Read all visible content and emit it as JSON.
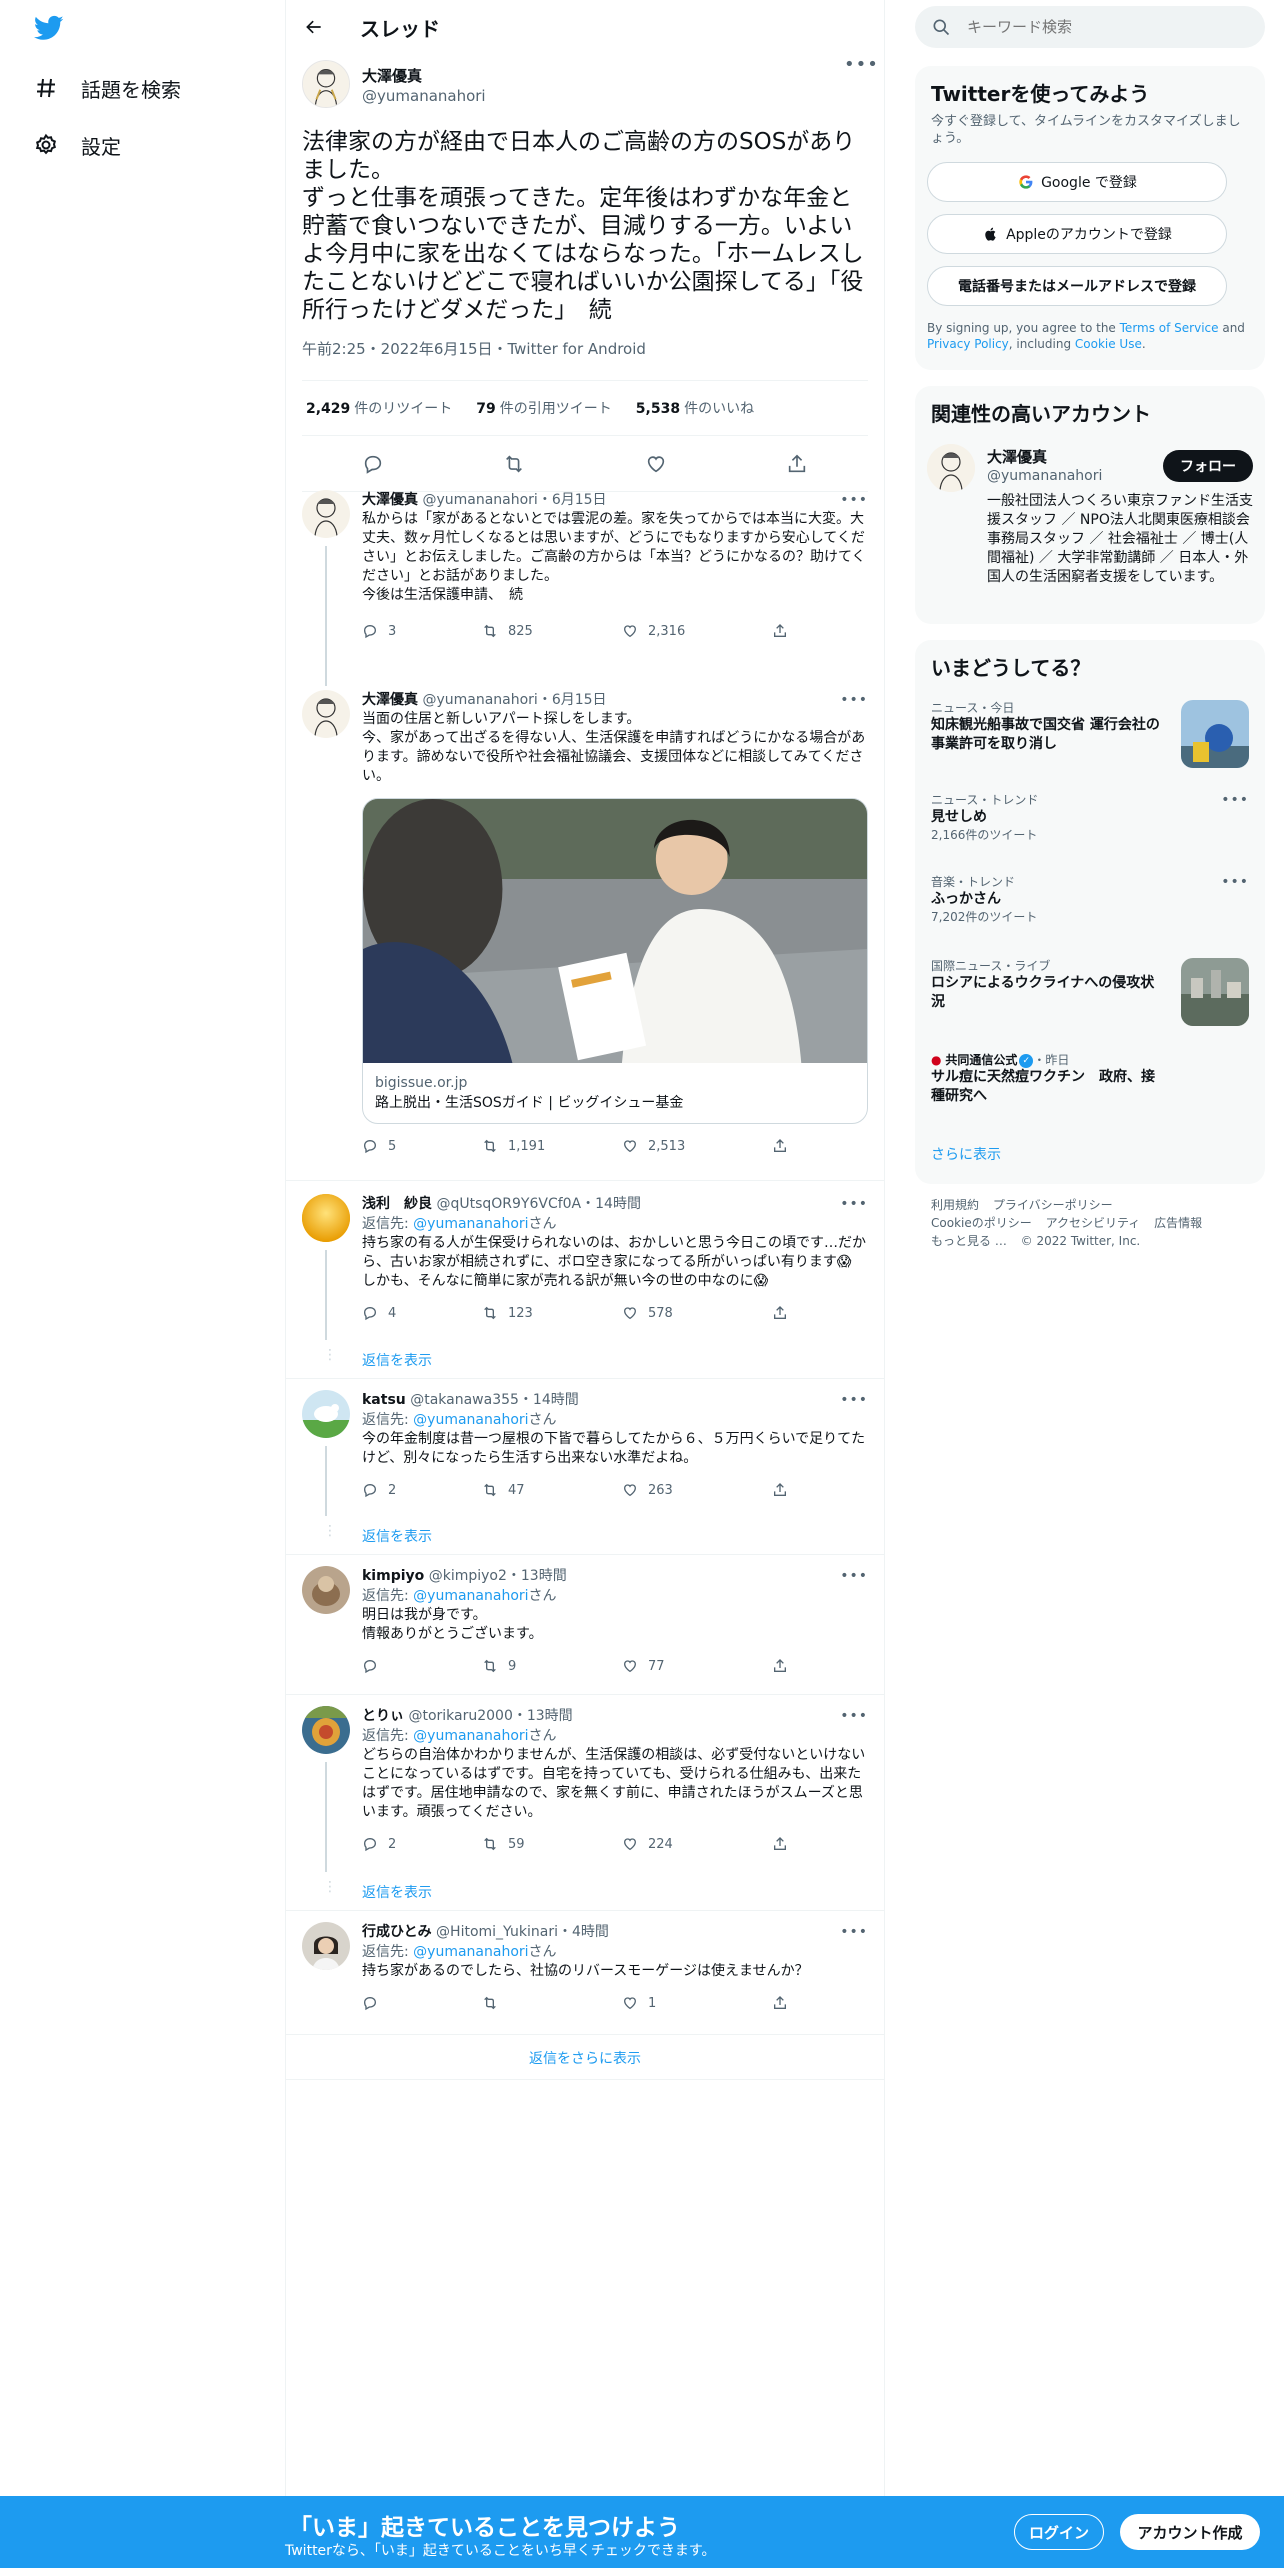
{
  "nav": {
    "explore_label": "話題を検索",
    "settings_label": "設定"
  },
  "header": {
    "title": "スレッド"
  },
  "main_tweet": {
    "name": "大澤優真",
    "handle": "@yumananahori",
    "text": "法律家の方が経由で日本人のご高齢の方のSOSがありました。\nずっと仕事を頑張ってきた。定年後はわずかな年金と貯蓄で食いつないできたが、目減りする一方。いよいよ今月中に家を出なくてはならなった。「ホームレスしたことないけどどこで寝ればいいか公園探してる」「役所行ったけどダメだった」　続",
    "meta": "午前2:25・2022年6月15日・Twitter for Android",
    "retweets": "2,429",
    "retweets_label": "件のリツイート",
    "quotes": "79",
    "quotes_label": "件の引用ツイート",
    "likes": "5,538",
    "likes_label": "件のいいね"
  },
  "replies": [
    {
      "name": "大澤優真",
      "handle": "@yumananahori",
      "time": "・6月15日",
      "text": "私からは「家があるとないとでは雲泥の差。家を失ってからでは本当に大変。大丈夫、数ヶ月忙しくなるとは思いますが、どうにでもなりますから安心してください」とお伝えしました。ご高齢の方からは「本当？どうにかなるの？助けてください」とお話がありました。\n今後は生活保護申請、　続",
      "reply_count": "3",
      "retweet_count": "825",
      "like_count": "2,316"
    },
    {
      "name": "大澤優真",
      "handle": "@yumananahori",
      "time": "・6月15日",
      "text": "当面の住居と新しいアパート探しをします。\n今、家があって出ざるを得ない人、生活保護を申請すればどうにかなる場合があります。諦めないで役所や社会福祉協議会、支援団体などに相談してみてください。",
      "card_domain": "bigissue.or.jp",
      "card_title": "路上脱出・生活SOSガイド | ビッグイシュー基金",
      "reply_count": "5",
      "retweet_count": "1,191",
      "like_count": "2,513"
    },
    {
      "name": "浅利　紗良",
      "handle": "@qUtsqOR9Y6VCf0A",
      "time": "・14時間",
      "reply_to_label": "返信先: ",
      "reply_to": "@yumananahori",
      "reply_to_suffix": "さん",
      "text": "持ち家の有る人が生保受けられないのは、おかしいと思う今日この頃です…だから、古いお家が相続されずに、ボロ空き家になってる所がいっぱい有ります😱　しかも、そんなに簡単に家が売れる訳が無い今の世の中なのに😱",
      "reply_count": "4",
      "retweet_count": "123",
      "like_count": "578",
      "show_replies": "返信を表示"
    },
    {
      "name": "katsu",
      "handle": "@takanawa355",
      "time": "・14時間",
      "reply_to_label": "返信先: ",
      "reply_to": "@yumananahori",
      "reply_to_suffix": "さん",
      "text": "今の年金制度は昔一つ屋根の下皆で暮らしてたから６、５万円くらいで足りてたけど、別々になったら生活すら出来ない水準だよね。",
      "reply_count": "2",
      "retweet_count": "47",
      "like_count": "263",
      "show_replies": "返信を表示"
    },
    {
      "name": "kimpiyo",
      "handle": "@kimpiyo2",
      "time": "・13時間",
      "reply_to_label": "返信先: ",
      "reply_to": "@yumananahori",
      "reply_to_suffix": "さん",
      "text": "明日は我が身です。\n情報ありがとうございます。",
      "reply_count": "",
      "retweet_count": "9",
      "like_count": "77"
    },
    {
      "name": "とりぃ",
      "handle": "@torikaru2000",
      "time": "・13時間",
      "reply_to_label": "返信先: ",
      "reply_to": "@yumananahori",
      "reply_to_suffix": "さん",
      "text": "どちらの自治体かわかりませんが、生活保護の相談は、必ず受付ないといけないことになっているはずです。自宅を持っていても、受けられる仕組みも、出来たはずです。居住地申請なので、家を無くす前に、申請されたほうがスムーズと思います。頑張ってください。",
      "reply_count": "2",
      "retweet_count": "59",
      "like_count": "224",
      "show_replies": "返信を表示"
    },
    {
      "name": "行成ひとみ",
      "handle": "@Hitomi_Yukinari",
      "time": "・4時間",
      "reply_to_label": "返信先: ",
      "reply_to": "@yumananahori",
      "reply_to_suffix": "さん",
      "text": "持ち家があるのでしたら、社協のリバースモーゲージは使えませんか？",
      "reply_count": "",
      "retweet_count": "",
      "like_count": "1"
    }
  ],
  "more_replies_label": "返信をさらに表示",
  "sidebar": {
    "search_placeholder": "キーワード検索",
    "signup": {
      "title": "Twitterを使ってみよう",
      "subtitle": "今すぐ登録して、タイムラインをカスタマイズしましょう。",
      "google_label": "Google で登録",
      "apple_label": "Appleのアカウントで登録",
      "phone_label": "電話番号またはメールアドレスで登録",
      "legal_prefix": "By signing up, you agree to the ",
      "terms_label": "Terms of Service",
      "legal_and": " and ",
      "privacy_label": "Privacy Policy",
      "legal_including": ", including ",
      "cookie_label": "Cookie Use",
      "legal_end": "."
    },
    "related": {
      "title": "関連性の高いアカウント",
      "name": "大澤優真",
      "handle": "@yumananahori",
      "follow_label": "フォロー",
      "bio": "一般社団法人つくろい東京ファンド生活支援スタッフ ／ NPO法人北関東医療相談会事務局スタッフ ／ 社会福祉士 ／ 博士(人間福祉) ／ 大学非常勤講師 ／ 日本人・外国人の生活困窮者支援をしています。"
    },
    "trends": {
      "title": "いまどうしてる？",
      "items": [
        {
          "meta": "ニュース・今日",
          "title": "知床観光船事故で国交省 運行会社の事業許可を取り消し",
          "count": ""
        },
        {
          "meta": "ニュース・トレンド",
          "title": "見せしめ",
          "count": "2,166件のツイート"
        },
        {
          "meta": "音楽・トレンド",
          "title": "ふっかさん",
          "count": "7,202件のツイート"
        },
        {
          "meta": "国際ニュース・ライブ",
          "title": "ロシアによるウクライナへの侵攻状況",
          "count": ""
        },
        {
          "meta": "共同通信公式",
          "meta_suffix": "・昨日",
          "title": "サル痘に天然痘ワクチン　政府、接種研究へ",
          "count": ""
        }
      ],
      "show_more": "さらに表示"
    },
    "footer": {
      "links": [
        "利用規約",
        "プライバシーポリシー",
        "Cookieのポリシー",
        "アクセシビリティ",
        "広告情報",
        "もっと見る …",
        "© 2022 Twitter, Inc."
      ]
    }
  },
  "bottom_bar": {
    "title": "「いま」起きていることを見つけよう",
    "subtitle": "Twitterなら、「いま」起きていることをいち早くチェックできます。",
    "login_label": "ログイン",
    "signup_label": "アカウント作成"
  },
  "colors": {
    "accent": "#1d9bf0",
    "text": "#0f1419",
    "muted": "#536471",
    "border": "#eff3f4"
  }
}
